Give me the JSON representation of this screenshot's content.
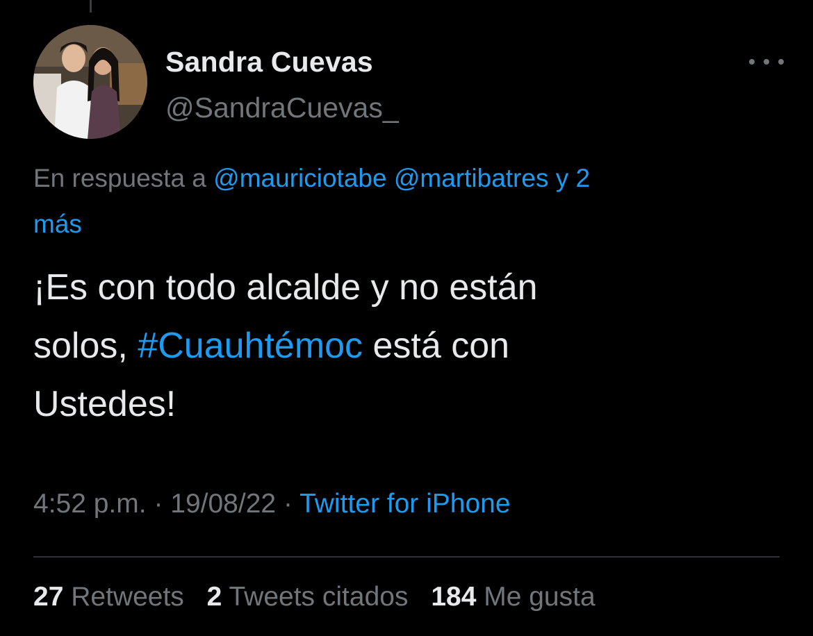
{
  "author": {
    "name": "Sandra Cuevas",
    "handle": "@SandraCuevas_"
  },
  "reply": {
    "prefix": "En respuesta a",
    "mention_1": "@mauriciotabe",
    "mention_2": "@martibatres",
    "more_a": "y 2",
    "more_b": "más"
  },
  "tweet": {
    "line1": "¡Es con todo alcalde y no están",
    "line2_start": "solos,",
    "hashtag": "#Cuauhtémoc",
    "line2_end": "está con",
    "line3": "Ustedes!"
  },
  "meta": {
    "time": "4:52 p.m.",
    "sep": "·",
    "date": "19/08/22",
    "source": "Twitter for iPhone"
  },
  "stats": {
    "retweets_count": "27",
    "retweets_label": "Retweets",
    "quotes_count": "2",
    "quotes_label": "Tweets citados",
    "likes_count": "184",
    "likes_label": "Me gusta"
  },
  "colors": {
    "background": "#000000",
    "text": "#e7e9ea",
    "muted": "#71767b",
    "link": "#1d9bf0"
  },
  "icons": {
    "more": "more-horizontal-icon"
  }
}
